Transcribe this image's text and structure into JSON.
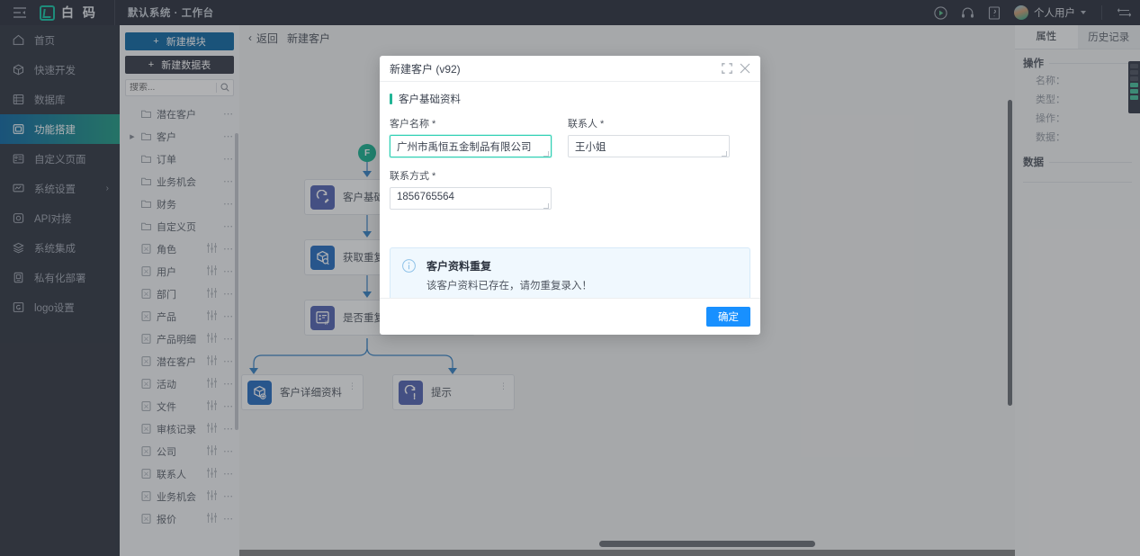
{
  "topbar": {
    "collapse_icon": "menu-collapse-icon",
    "logo_text": "白 码",
    "breadcrumb": "默认系统 · 工作台",
    "icons": [
      "play-circle-icon",
      "headset-icon",
      "book-icon"
    ],
    "user_label": "个人用户",
    "switch_icon": "switch-icon"
  },
  "sidebar": {
    "items": [
      {
        "label": "首页",
        "icon": "home-icon",
        "active": false,
        "arrow": false
      },
      {
        "label": "快速开发",
        "icon": "cube-icon",
        "active": false,
        "arrow": false
      },
      {
        "label": "数据库",
        "icon": "database-icon",
        "active": false,
        "arrow": false
      },
      {
        "label": "功能搭建",
        "icon": "build-icon",
        "active": true,
        "arrow": false
      },
      {
        "label": "自定义页面",
        "icon": "page-icon",
        "active": false,
        "arrow": false
      },
      {
        "label": "系统设置",
        "icon": "settings-icon",
        "active": false,
        "arrow": true
      },
      {
        "label": "API对接",
        "icon": "api-icon",
        "active": false,
        "arrow": false
      },
      {
        "label": "系统集成",
        "icon": "layers-icon",
        "active": false,
        "arrow": false
      },
      {
        "label": "私有化部署",
        "icon": "server-icon",
        "active": false,
        "arrow": false
      },
      {
        "label": "logo设置",
        "icon": "logo-icon",
        "active": false,
        "arrow": false
      }
    ]
  },
  "tree_panel": {
    "new_module_label": "新建模块",
    "new_table_label": "新建数据表",
    "search_placeholder": "搜索...",
    "search_value": "",
    "items": [
      {
        "label": "潜在客户",
        "type": "folder",
        "caret": false,
        "slider": false
      },
      {
        "label": "客户",
        "type": "folder",
        "caret": true,
        "slider": false
      },
      {
        "label": "订单",
        "type": "folder",
        "caret": false,
        "slider": false
      },
      {
        "label": "业务机会",
        "type": "folder",
        "caret": false,
        "slider": false
      },
      {
        "label": "财务",
        "type": "folder",
        "caret": false,
        "slider": false
      },
      {
        "label": "自定义页",
        "type": "folder",
        "caret": false,
        "slider": false
      },
      {
        "label": "角色",
        "type": "table",
        "caret": false,
        "slider": true
      },
      {
        "label": "用户",
        "type": "table",
        "caret": false,
        "slider": true
      },
      {
        "label": "部门",
        "type": "table",
        "caret": false,
        "slider": true
      },
      {
        "label": "产品",
        "type": "table",
        "caret": false,
        "slider": true
      },
      {
        "label": "产品明细",
        "type": "table",
        "caret": false,
        "slider": true
      },
      {
        "label": "潜在客户",
        "type": "table",
        "caret": false,
        "slider": true
      },
      {
        "label": "活动",
        "type": "table",
        "caret": false,
        "slider": true
      },
      {
        "label": "文件",
        "type": "table",
        "caret": false,
        "slider": true
      },
      {
        "label": "审核记录",
        "type": "table",
        "caret": false,
        "slider": true
      },
      {
        "label": "公司",
        "type": "table",
        "caret": false,
        "slider": true
      },
      {
        "label": "联系人",
        "type": "table",
        "caret": false,
        "slider": true
      },
      {
        "label": "业务机会",
        "type": "table",
        "caret": false,
        "slider": true
      },
      {
        "label": "报价",
        "type": "table",
        "caret": false,
        "slider": true
      }
    ]
  },
  "canvas": {
    "back_label": "返回",
    "page_title": "新建客户",
    "start_node_label": "F",
    "nodes": [
      {
        "label": "客户基础资料",
        "icon": "form-edit-icon",
        "color": "lav"
      },
      {
        "label": "获取重复数据",
        "icon": "data-search-icon",
        "color": "blue"
      },
      {
        "label": "是否重复",
        "icon": "condition-if-icon",
        "color": "lav"
      },
      {
        "label": "客户详细资料",
        "icon": "data-add-icon",
        "color": "blue"
      },
      {
        "label": "提示",
        "icon": "alert-icon",
        "color": "lav"
      }
    ]
  },
  "right_panel": {
    "tabs": [
      {
        "label": "属性",
        "active": true
      },
      {
        "label": "历史记录",
        "active": false
      }
    ],
    "sections": [
      {
        "title": "操作",
        "fields": [
          "名称：",
          "类型：",
          "操作：",
          "数据："
        ]
      },
      {
        "title": "数据",
        "fields": []
      }
    ]
  },
  "modal": {
    "title": "新建客户 (v92)",
    "expand_icon": "expand-icon",
    "close_icon": "close-icon",
    "section_title": "客户基础资料",
    "fields": [
      {
        "label": "客户名称",
        "required": true,
        "value": "广州市禹恒五金制品有限公司",
        "focused": true
      },
      {
        "label": "联系人",
        "required": true,
        "value": "王小姐",
        "focused": false
      },
      {
        "label": "联系方式",
        "required": true,
        "value": "1856765564",
        "focused": false
      }
    ],
    "alert": {
      "icon": "info-circle-icon",
      "title": "客户资料重复",
      "text": "该客户资料已存在，请勿重复录入！"
    },
    "ok_label": "确定"
  },
  "colors": {
    "accent_teal": "#22b596",
    "primary_blue": "#1890ff",
    "nav_active_from": "#1a6fa8",
    "nav_active_to": "#2aa089",
    "topbar_bg": "#353a45",
    "sidebar_bg": "#3a3f4a",
    "alert_bg": "#f0f8fe"
  }
}
